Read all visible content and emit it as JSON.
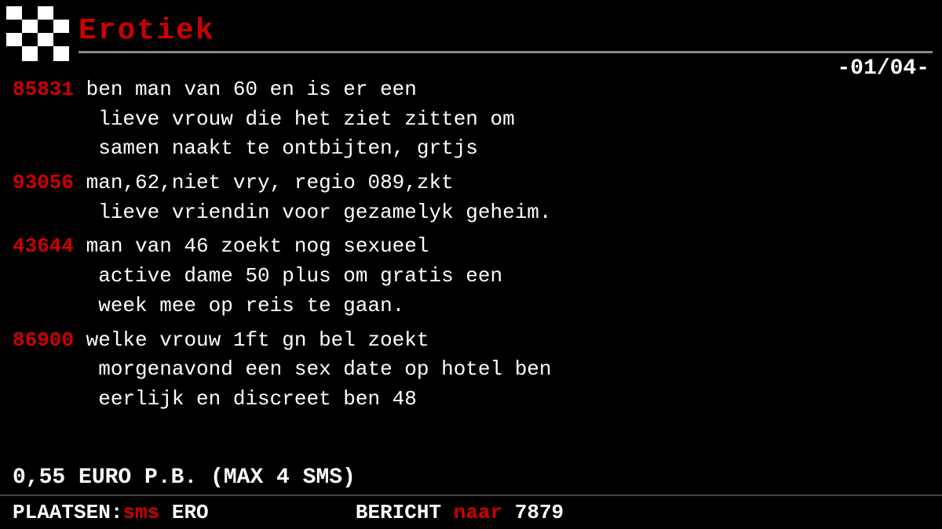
{
  "header": {
    "title": "Erotiek",
    "page_number": "-01/04-"
  },
  "messages": [
    {
      "id": "85831",
      "text": " ben man van 60 en is er een lieve vrouw die het ziet zitten om samen naakt te ontbijten, grtjs"
    },
    {
      "id": "93056",
      "text": " man,62,niet vry, regio 089,zkt lieve vriendin voor gezamelyk geheim."
    },
    {
      "id": "43644",
      "text": " man van 46 zoekt nog sexueel active dame 50 plus om gratis een week mee op reis te gaan."
    },
    {
      "id": "86900",
      "text": " welke vrouw 1ft gn bel zoekt morgenavond een sex date op hotel ben eerlijk en discreet ben 48"
    }
  ],
  "footer": {
    "cost": "0,55 EURO P.B. (MAX 4 SMS)",
    "plaatsen_label": "PLAATSEN:",
    "plaatsen_value": "sms",
    "fro_label": "ERO",
    "bericht_label": "BERICHT",
    "naar_label": "naar",
    "number": "7879"
  }
}
